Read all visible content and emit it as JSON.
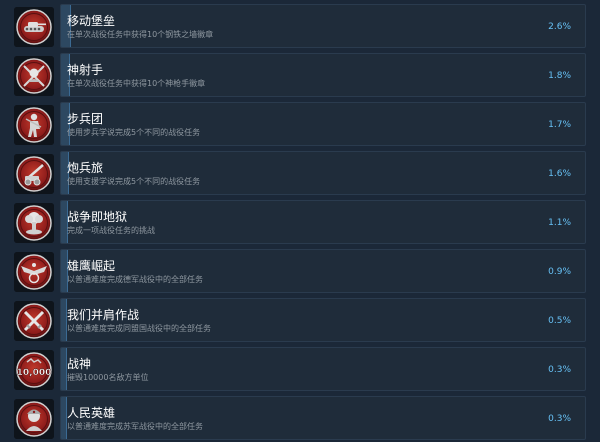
{
  "colors": {
    "background": "#1b2838",
    "bar": "#1f2c3a",
    "fill": "#2d4861",
    "percent_text": "#67c1f5",
    "icon_red": "#8b1a1a"
  },
  "achievements": [
    {
      "title": "移动堡垒",
      "description": "在单次战役任务中获得10个钢铁之墙徽章",
      "percent": "2.6%",
      "fill": 0.026,
      "icon": "tank-icon"
    },
    {
      "title": "神射手",
      "description": "在单次战役任务中获得10个神枪手徽章",
      "percent": "1.8%",
      "fill": 0.018,
      "icon": "crossed-rifles-icon"
    },
    {
      "title": "步兵团",
      "description": "使用步兵学说完成5个不同的战役任务",
      "percent": "1.7%",
      "fill": 0.017,
      "icon": "infantry-soldier-icon"
    },
    {
      "title": "炮兵旅",
      "description": "使用支援学说完成5个不同的战役任务",
      "percent": "1.6%",
      "fill": 0.016,
      "icon": "artillery-gun-icon"
    },
    {
      "title": "战争即地狱",
      "description": "完成一项战役任务的挑战",
      "percent": "1.1%",
      "fill": 0.011,
      "icon": "explosion-icon"
    },
    {
      "title": "雄鹰崛起",
      "description": "以普通难度完成德军战役中的全部任务",
      "percent": "0.9%",
      "fill": 0.009,
      "icon": "eagle-emblem-icon"
    },
    {
      "title": "我们并肩作战",
      "description": "以普通难度完成同盟国战役中的全部任务",
      "percent": "0.5%",
      "fill": 0.005,
      "icon": "crossed-swords-icon"
    },
    {
      "title": "战神",
      "description": "摧毁10000名敌方单位",
      "percent": "0.3%",
      "fill": 0.003,
      "icon": "ten-thousand-icon",
      "icon_text": "10,000"
    },
    {
      "title": "人民英雄",
      "description": "以普通难度完成苏军战役中的全部任务",
      "percent": "0.3%",
      "fill": 0.003,
      "icon": "soviet-soldier-icon"
    }
  ]
}
